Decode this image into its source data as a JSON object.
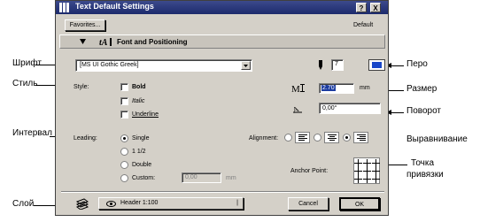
{
  "window": {
    "title": "Text Default Settings",
    "help": "?",
    "close": "X"
  },
  "toolbar": {
    "favorites": "Favorites...",
    "default_label": "Default"
  },
  "section": {
    "title": "Font and Positioning"
  },
  "font": {
    "value": "[MS UI Gothic Greek]"
  },
  "pen": {
    "value": "7",
    "swatch_color": "#1846c8"
  },
  "style": {
    "label": "Style:",
    "bold": "Bold",
    "italic": "Italic",
    "underline": "Underline"
  },
  "size": {
    "value": "2.70",
    "unit": "mm"
  },
  "rotation": {
    "value": "0,00°"
  },
  "leading": {
    "label": "Leading:",
    "options": [
      "Single",
      "1 1/2",
      "Double",
      "Custom:"
    ],
    "selected": "Single",
    "custom_value": "0,00",
    "custom_unit": "mm"
  },
  "alignment": {
    "label": "Alignment:",
    "selected": "right"
  },
  "anchor": {
    "label": "Anchor Point:"
  },
  "layer": {
    "value": "Header 1:100"
  },
  "buttons": {
    "cancel": "Cancel",
    "ok": "OK"
  },
  "annotations": {
    "font": "Шрифт",
    "style": "Стиль",
    "leading": "Интервал",
    "layer": "Слой",
    "pen": "Перо",
    "size": "Размер",
    "rotation": "Поворот",
    "alignment": "Выравнивание",
    "anchor_line1": "Точка",
    "anchor_line2": "привязки"
  }
}
